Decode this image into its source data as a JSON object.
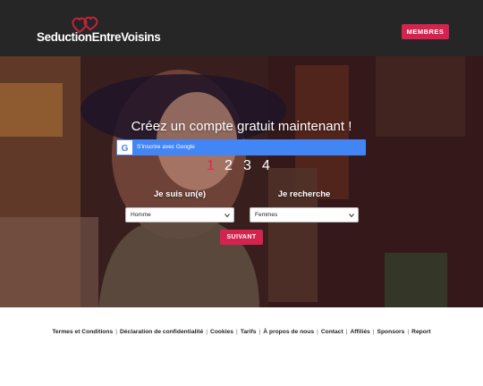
{
  "header": {
    "logo_text": "SeductionEntreVoisins",
    "members_label": "MEMBRES"
  },
  "hero": {
    "title": "Créez un compte gratuit maintenant !",
    "google_label": "S'inscrire avec Google",
    "steps": [
      "1",
      "2",
      "3",
      "4"
    ],
    "active_step": 1,
    "iam_label": "Je suis un(e)",
    "seek_label": "Je recherche",
    "iam_value": "Homme",
    "seek_value": "Femmes",
    "next_label": "SUIVANT"
  },
  "footer": {
    "links": [
      "Termes et Conditions",
      "Déclaration de confidentialité",
      "Cookies",
      "Tarifs",
      "À propos de nous",
      "Contact",
      "Affiliés",
      "Sponsors",
      "Report"
    ]
  },
  "colors": {
    "header_bg": "#262626",
    "accent": "#d4234f",
    "google_blue": "#4285f4"
  }
}
